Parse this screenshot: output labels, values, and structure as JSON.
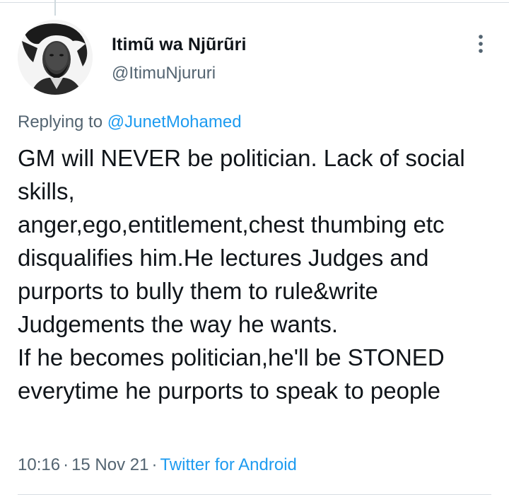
{
  "tweet": {
    "author": {
      "display_name": "Itimũ wa Njũrũri",
      "handle": "@ItimuNjururi",
      "avatar": "profile-photo"
    },
    "replying_to_prefix": "Replying to ",
    "replying_to_handle": "@JunetMohamed",
    "text": "GM will NEVER be politician. Lack of social skills,\nanger,ego,entitlement,chest thumbing etc disqualifies him.He lectures Judges and purports to bully them to rule&write Judgements the way he wants.\nIf he becomes politician,he'll be STONED everytime he purports to speak to people",
    "time": "10:16",
    "separator": "·",
    "date": "15 Nov 21",
    "source": "Twitter for Android",
    "more_icon": "more-vertical-icon"
  },
  "colors": {
    "primary_text": "#0f1419",
    "secondary_text": "#536471",
    "link": "#1d9bf0",
    "divider": "#d7dde2"
  }
}
